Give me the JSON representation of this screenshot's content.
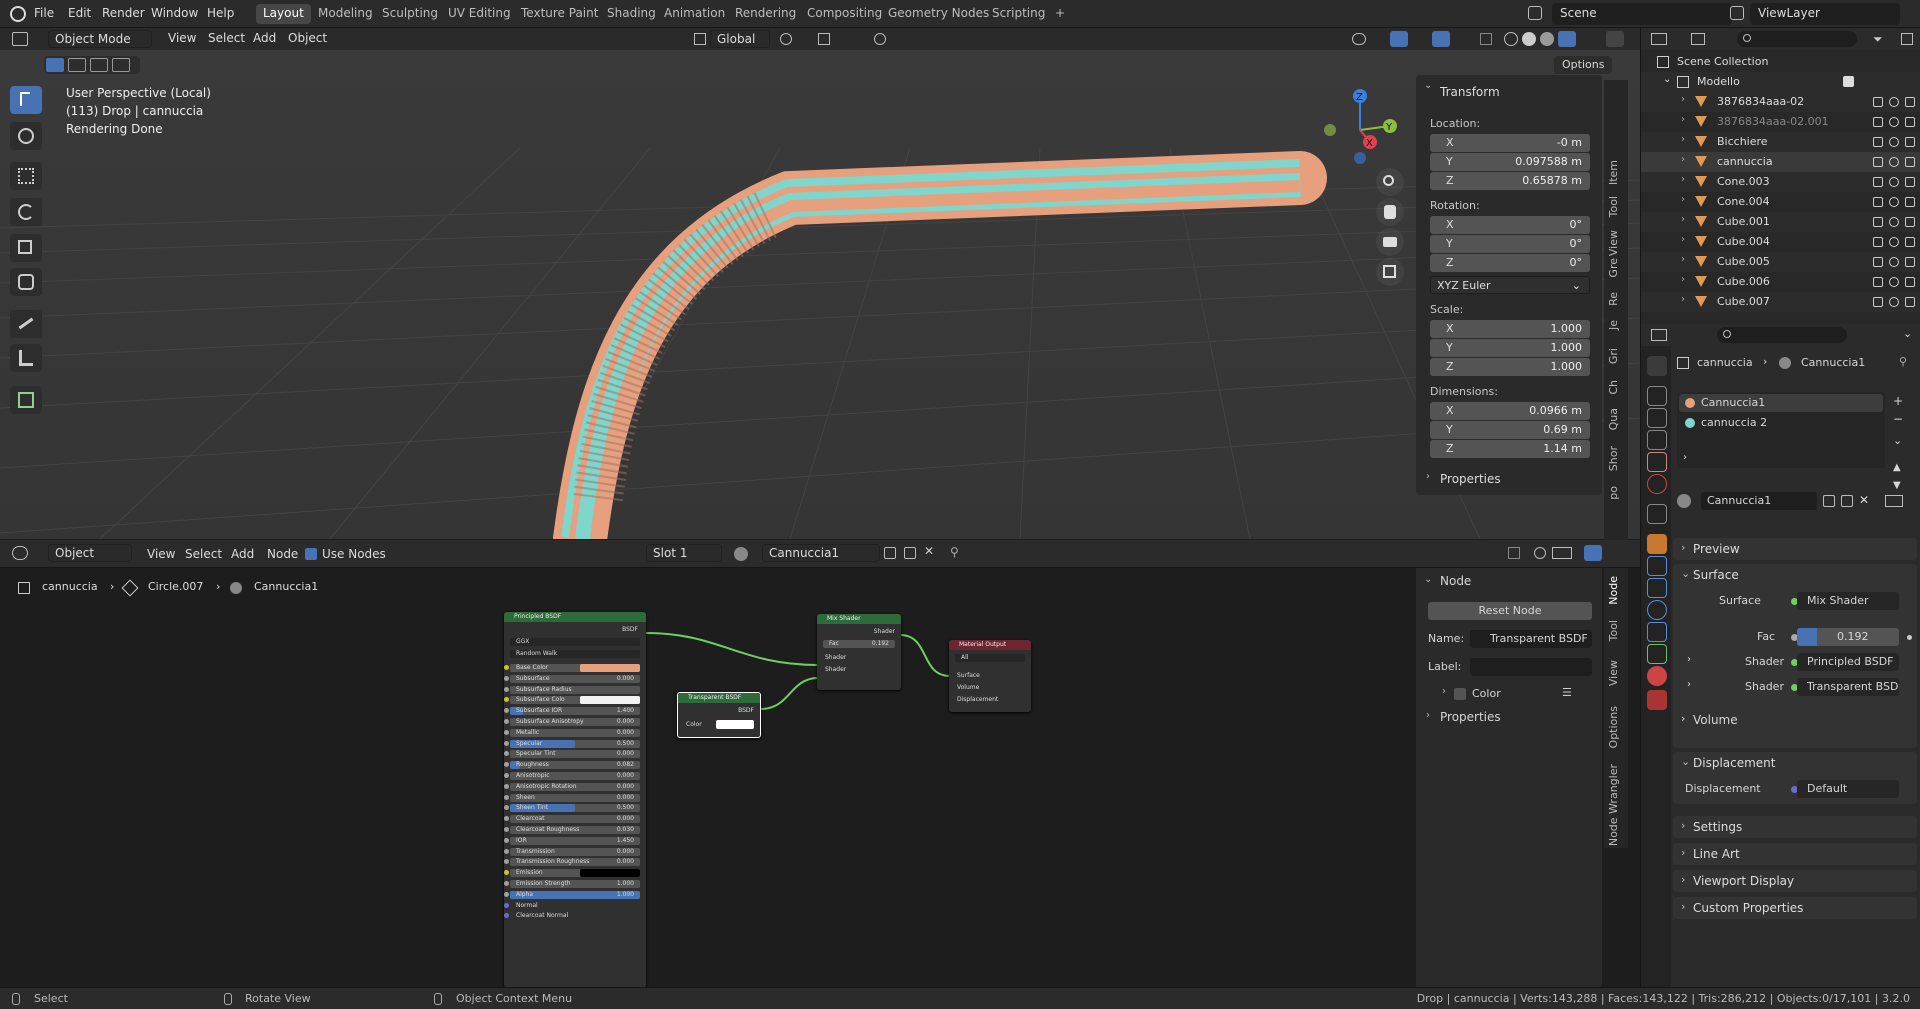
{
  "topbar": {
    "menus": [
      "File",
      "Edit",
      "Render",
      "Window",
      "Help"
    ],
    "workspaces": [
      "Layout",
      "Modeling",
      "Sculpting",
      "UV Editing",
      "Texture Paint",
      "Shading",
      "Animation",
      "Rendering",
      "Compositing",
      "Geometry Nodes",
      "Scripting"
    ],
    "add_tab": "+",
    "scene": "Scene",
    "view_layer": "ViewLayer"
  },
  "viewport": {
    "mode": "Object Mode",
    "menus": [
      "View",
      "Select",
      "Add",
      "Object"
    ],
    "orientation": "Global",
    "options": "Options",
    "overlay_lines": [
      "User Perspective (Local)",
      "(113) Drop | cannuccia",
      "Rendering Done"
    ],
    "gizmo": {
      "x": "X",
      "y": "Y",
      "z": "Z"
    }
  },
  "npanel": {
    "transform_title": "Transform",
    "location_label": "Location:",
    "location": [
      {
        "axis": "X",
        "value": "-0 m"
      },
      {
        "axis": "Y",
        "value": "0.097588 m"
      },
      {
        "axis": "Z",
        "value": "0.65878 m"
      }
    ],
    "rotation_label": "Rotation:",
    "rotation": [
      {
        "axis": "X",
        "value": "0°"
      },
      {
        "axis": "Y",
        "value": "0°"
      },
      {
        "axis": "Z",
        "value": "0°"
      }
    ],
    "rotation_mode": "XYZ Euler",
    "scale_label": "Scale:",
    "scale": [
      {
        "axis": "X",
        "value": "1.000"
      },
      {
        "axis": "Y",
        "value": "1.000"
      },
      {
        "axis": "Z",
        "value": "1.000"
      }
    ],
    "dimensions_label": "Dimensions:",
    "dimensions": [
      {
        "axis": "X",
        "value": "0.0966 m"
      },
      {
        "axis": "Y",
        "value": "0.69 m"
      },
      {
        "axis": "Z",
        "value": "1.14 m"
      }
    ],
    "properties": "Properties",
    "side_tabs": [
      "Item",
      "Tool",
      "View",
      "Gre",
      "Re",
      "Je",
      "Gri",
      "Ch",
      "Qua",
      "Shor",
      "po"
    ]
  },
  "node_editor": {
    "editor_type": "Object",
    "menus": [
      "View",
      "Select",
      "Add",
      "Node"
    ],
    "use_nodes": "Use Nodes",
    "slot": "Slot 1",
    "material": "Cannuccia1",
    "breadcrumb": [
      "cannuccia",
      "Circle.007",
      "Cannuccia1"
    ],
    "principled": {
      "title": "Principled BSDF",
      "out": "BSDF",
      "dist": "GGX",
      "sss": "Random Walk",
      "rows": [
        {
          "l": "Base Color",
          "r": ""
        },
        {
          "l": "Subsurface",
          "r": "0.000"
        },
        {
          "l": "Subsurface Radius",
          "r": ""
        },
        {
          "l": "Subsurface Colo",
          "r": ""
        },
        {
          "l": "Subsurface IOR",
          "r": "1.400"
        },
        {
          "l": "Subsurface Anisotropy",
          "r": "0.000"
        },
        {
          "l": "Metallic",
          "r": "0.000"
        },
        {
          "l": "Specular",
          "r": "0.500"
        },
        {
          "l": "Specular Tint",
          "r": "0.000"
        },
        {
          "l": "Roughness",
          "r": "0.082"
        },
        {
          "l": "Anisotropic",
          "r": "0.000"
        },
        {
          "l": "Anisotropic Rotation",
          "r": "0.000"
        },
        {
          "l": "Sheen",
          "r": "0.000"
        },
        {
          "l": "Sheen Tint",
          "r": "0.500"
        },
        {
          "l": "Clearcoat",
          "r": "0.000"
        },
        {
          "l": "Clearcoat Roughness",
          "r": "0.030"
        },
        {
          "l": "IOR",
          "r": "1.450"
        },
        {
          "l": "Transmission",
          "r": "0.000"
        },
        {
          "l": "Transmission Roughness",
          "r": "0.000"
        },
        {
          "l": "Emission",
          "r": ""
        },
        {
          "l": "Emission Strength",
          "r": "1.000"
        },
        {
          "l": "Alpha",
          "r": "1.000"
        },
        {
          "l": "Normal",
          "r": ""
        },
        {
          "l": "Clearcoat Normal",
          "r": ""
        }
      ]
    },
    "transparent": {
      "title": "Transparent BSDF",
      "out": "BSDF",
      "color": "Color"
    },
    "mix": {
      "title": "Mix Shader",
      "out": "Shader",
      "fac": "Fac",
      "fac_val": "0.192",
      "in1": "Shader",
      "in2": "Shader"
    },
    "output": {
      "title": "Material Output",
      "target": "All",
      "surface": "Surface",
      "volume": "Volume",
      "displacement": "Displacement"
    }
  },
  "node_side": {
    "title": "Node",
    "reset": "Reset Node",
    "name_label": "Name:",
    "name_value": "Transparent BSDF",
    "label_label": "Label:",
    "color": "Color",
    "properties": "Properties",
    "tabs": [
      "Node",
      "Tool",
      "View",
      "Options",
      "Node Wrangler"
    ]
  },
  "outliner": {
    "root": "Scene Collection",
    "collection": "Modello",
    "items": [
      "3876834aaa-02",
      "3876834aaa-02.001",
      "Bicchiere",
      "cannuccia",
      "Cone.003",
      "Cone.004",
      "Cube.001",
      "Cube.004",
      "Cube.005",
      "Cube.006",
      "Cube.007"
    ]
  },
  "properties": {
    "breadcrumb_obj": "cannuccia",
    "breadcrumb_mat": "Cannuccia1",
    "slots": [
      "Cannuccia1",
      "cannuccia 2"
    ],
    "material_name": "Cannuccia1",
    "preview": "Preview",
    "surface": "Surface",
    "surface_label": "Surface",
    "surface_value": "Mix Shader",
    "fac_label": "Fac",
    "fac_value": "0.192",
    "shader_label": "Shader",
    "shader1": "Principled BSDF",
    "shader2": "Transparent BSDF",
    "volume": "Volume",
    "displacement": "Displacement",
    "displacement_label": "Displacement",
    "displacement_value": "Default",
    "settings": "Settings",
    "line_art": "Line Art",
    "viewport_display": "Viewport Display",
    "custom_properties": "Custom Properties"
  },
  "statusbar": {
    "select": "Select",
    "rotate": "Rotate View",
    "context": "Object Context Menu",
    "stats": "Drop | cannuccia | Verts:143,288 | Faces:143,122 | Tris:286,212 | Objects:0/17,101 | 3.2.0"
  },
  "colors": {
    "accent": "#4772b3",
    "straw_orange": "#e7a07e",
    "straw_cyan": "#7fd6cc",
    "node_green": "#2e6b3a",
    "node_red": "#6e2530"
  }
}
